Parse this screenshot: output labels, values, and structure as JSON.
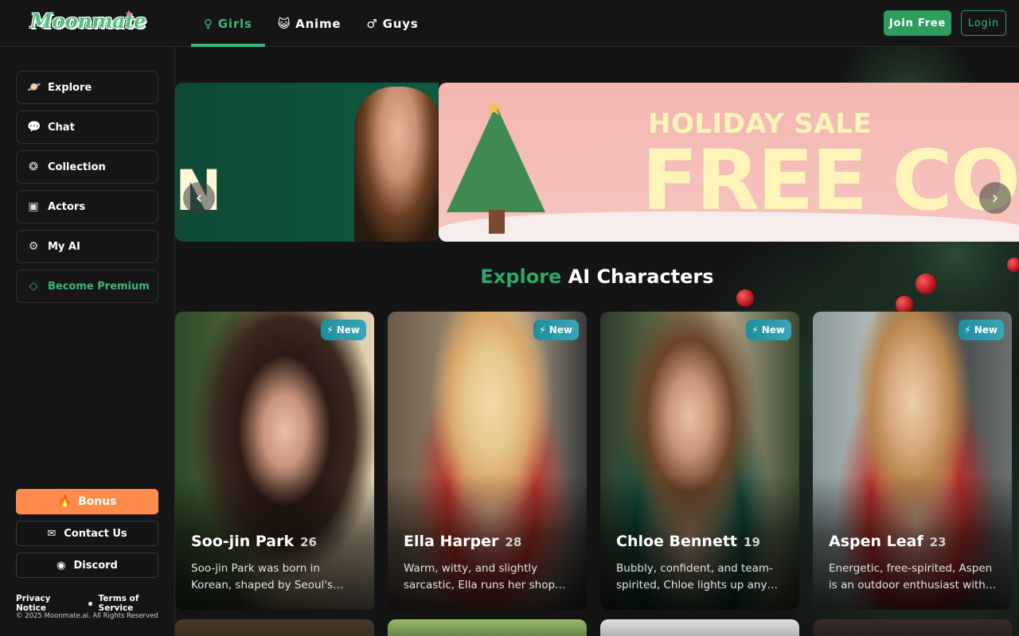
{
  "header": {
    "logo": "Moonmate",
    "tabs": [
      {
        "label": "Girls",
        "icon": "female-icon"
      },
      {
        "label": "Anime",
        "icon": "cat-icon"
      },
      {
        "label": "Guys",
        "icon": "male-icon"
      }
    ],
    "join_label": "Join Free",
    "login_label": "Login"
  },
  "sidebar": {
    "items": [
      {
        "label": "Explore",
        "icon": "planet-icon"
      },
      {
        "label": "Chat",
        "icon": "chat-icon"
      },
      {
        "label": "Collection",
        "icon": "collection-icon"
      },
      {
        "label": "Actors",
        "icon": "actors-icon"
      },
      {
        "label": "My AI",
        "icon": "robot-icon"
      },
      {
        "label": "Become Premium",
        "icon": "diamond-icon"
      }
    ],
    "bonus_label": "Bonus",
    "contact_label": "Contact Us",
    "discord_label": "Discord",
    "privacy_label": "Privacy Notice",
    "terms_label": "Terms of Service",
    "copyright": "© 2025 Moonmate.ai. All Rights Reserved"
  },
  "banner": {
    "left_text": "N",
    "line1": "HOLIDAY SALE",
    "line2": "FREE CO"
  },
  "section": {
    "title_green": "Explore",
    "title_rest": "AI Characters"
  },
  "cards": [
    {
      "name": "Soo-jin Park",
      "age": "26",
      "badge": "New",
      "desc": "Soo-jin Park was born in Korean, shaped by Seoul's…"
    },
    {
      "name": "Ella Harper",
      "age": "28",
      "badge": "New",
      "desc": "Warm, witty, and slightly sarcastic, Ella runs her shop…"
    },
    {
      "name": "Chloe Bennett",
      "age": "19",
      "badge": "New",
      "desc": "Bubbly, confident, and team-spirited, Chloe lights up any…"
    },
    {
      "name": "Aspen Leaf",
      "age": "23",
      "badge": "New",
      "desc": "Energetic, free-spirited, Aspen is an outdoor enthusiast with…"
    }
  ],
  "colors": {
    "accent": "#2f9c60",
    "bonus": "#ff8a4c",
    "badge": "#2aa0b0"
  }
}
